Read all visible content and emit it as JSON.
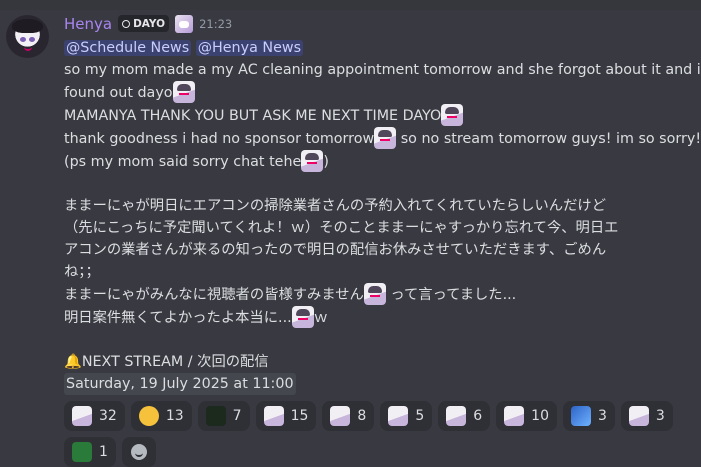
{
  "message": {
    "author": "Henya",
    "tag": "DAYO",
    "time": "21:23",
    "mentions": [
      "@Schedule News",
      "@Henya News"
    ],
    "lines": {
      "l1": "so my mom made a my AC cleaning appointment tomorrow and she forgot about it and i just",
      "l2": "found out dayo",
      "l3": "MAMANYA THANK YOU BUT ASK ME NEXT TIME DAYO",
      "l4a": "thank goodness i had no sponsor tomorrow",
      "l4b": " so no stream tomorrow guys! im so sorry!",
      "l5a": "(ps my mom said sorry chat tehe",
      "l5b": ")",
      "jp1": "ままーにゃが明日にエアコンの掃除業者さんの予約入れてくれていたらしいんだけど",
      "jp2": "（先にこっちに予定聞いてくれよ！ｗ）そのことままーにゃすっかり忘れて今、明日エ",
      "jp3": "アコンの業者さんが来るの知ったので明日の配信お休みさせていただきます、ごめん",
      "jp4": "ね；；",
      "jp5a": "ままーにゃがみんなに視聴者の皆様すみません",
      "jp5b": " って言ってました...",
      "jp6a": "明日案件無くてよかったよ本当に...",
      "jp6b": "ｗ",
      "next_stream": "NEXT STREAM / 次回の配信",
      "date": "Saturday, 19 July 2025 at 11:00"
    }
  },
  "reactions": [
    {
      "emoji": "henya-emote",
      "count": "32"
    },
    {
      "emoji": "salute-face",
      "count": "13"
    },
    {
      "emoji": "dark-emote",
      "count": "7"
    },
    {
      "emoji": "henya-emote",
      "count": "15"
    },
    {
      "emoji": "henya-emote",
      "count": "8"
    },
    {
      "emoji": "henya-emote",
      "count": "5"
    },
    {
      "emoji": "henya-emote",
      "count": "6"
    },
    {
      "emoji": "henya-emote",
      "count": "10"
    },
    {
      "emoji": "blue-emote",
      "count": "3"
    },
    {
      "emoji": "henya-emote",
      "count": "3"
    },
    {
      "emoji": "frog-emote",
      "count": "1"
    }
  ],
  "colors": {
    "background": "#393a41",
    "username": "#a985f1",
    "mention_bg": "#3c4270",
    "reaction_bg": "#2f3036"
  }
}
